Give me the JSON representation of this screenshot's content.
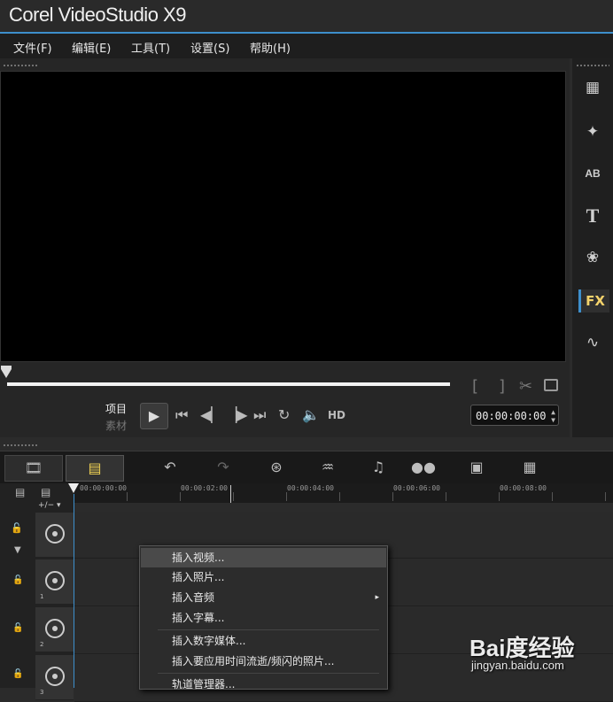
{
  "app": {
    "title": "Corel VideoStudio X9"
  },
  "menu": [
    "文件(F)",
    "编辑(E)",
    "工具(T)",
    "设置(S)",
    "帮助(H)"
  ],
  "player": {
    "mode_project": "项目",
    "mode_clip": "素材",
    "hd_label": "HD",
    "timecode": "00:00:00:00",
    "mark_in": "[",
    "mark_out": "]"
  },
  "library_tools": [
    "media-icon",
    "instant-project-icon",
    "transition-icon",
    "title-icon",
    "graphic-icon",
    "filter-icon",
    "path-icon"
  ],
  "library_fx_label": "FX",
  "ruler": [
    "00:00:00:00",
    "00:00:02:00",
    "00:00:04:00",
    "00:00:06:00",
    "00:00:08:00"
  ],
  "tracks": {
    "add_remove": "+/− ▾",
    "numbers": [
      "1",
      "2",
      "3"
    ]
  },
  "context_menu": {
    "items": [
      "插入视频...",
      "插入照片...",
      "插入音频",
      "插入字幕...",
      "插入数字媒体...",
      "插入要应用时间流逝/频闪的照片...",
      "轨道管理器..."
    ],
    "submenu_arrow": "▸"
  },
  "watermark": {
    "logo": "Bai度经验",
    "url": "jingyan.baidu.com"
  }
}
